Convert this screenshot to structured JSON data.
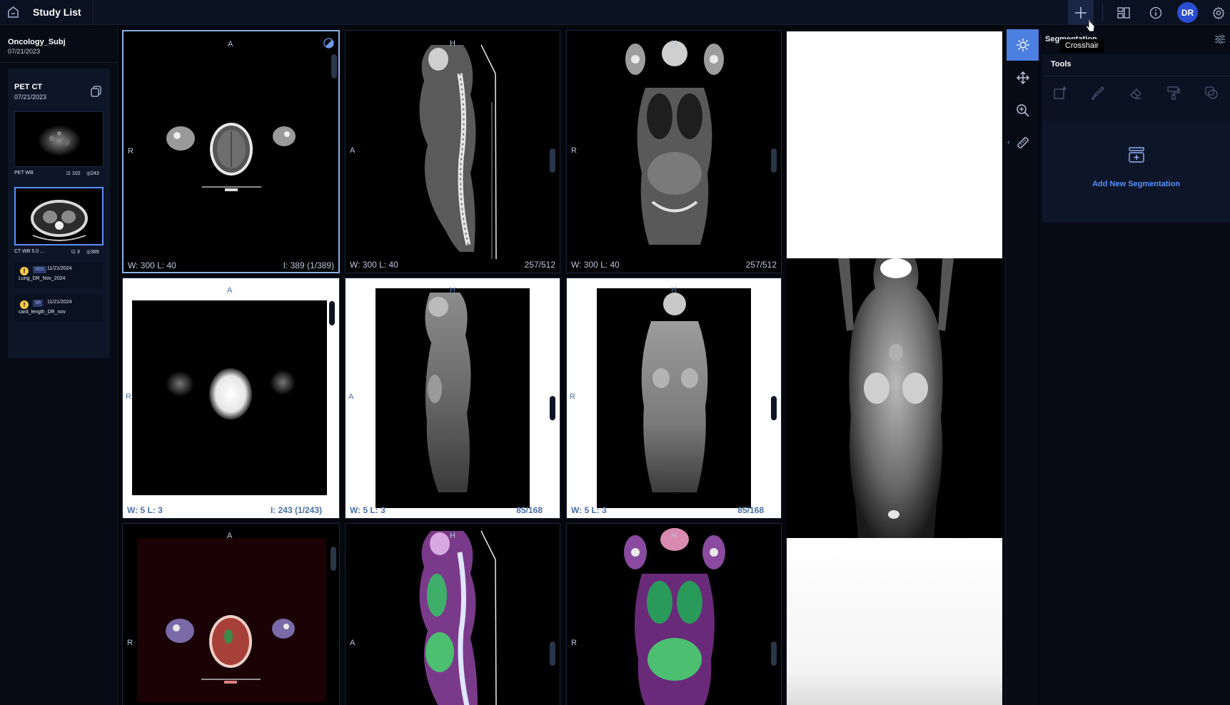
{
  "header": {
    "title": "Study List",
    "tooltip": "Crosshair",
    "user_initials": "DR",
    "icons": [
      "home-icon",
      "crosshair-icon",
      "layout-icon",
      "info-icon",
      "settings-icon"
    ]
  },
  "patient": {
    "name": "Oncology_Subj",
    "date": "07/21/2023"
  },
  "study": {
    "title": "PET CT",
    "date": "07/21/2023",
    "series": [
      {
        "label": "PET WB",
        "frames": "102",
        "images": "243"
      },
      {
        "label": "CT WB 5.0 ...",
        "frames": "3",
        "images": "389"
      }
    ],
    "derived": [
      {
        "type": "SEG",
        "date": "11/21/2024",
        "name": "Lung_DR_Nov_2024"
      },
      {
        "type": "SR",
        "date": "11/21/2024",
        "name": "card_length_DR_nov"
      }
    ]
  },
  "viewports": {
    "ct_axial": {
      "top": "A",
      "left": "R",
      "wl": "W:  300  L:  40",
      "index": "I: 389 (1/389)"
    },
    "ct_sagittal": {
      "top": "H",
      "left": "A",
      "wl": "W:  300  L:  40",
      "index": "257/512"
    },
    "ct_coronal": {
      "top": "H",
      "left": "R",
      "wl": "W:  300  L:  40",
      "index": "257/512"
    },
    "pt_axial": {
      "top": "A",
      "left": "R",
      "wl": "W:  5  L:  3",
      "index": "I: 243 (1/243)"
    },
    "pt_sagittal": {
      "top": "H",
      "left": "A",
      "wl": "W:  5  L:  3",
      "index": "85/168"
    },
    "pt_coronal": {
      "top": "H",
      "left": "R",
      "wl": "W:  5  L:  3",
      "index": "85/168"
    },
    "fu_axial": {
      "top": "A",
      "left": "R"
    },
    "fu_sagittal": {
      "top": "H",
      "left": "A"
    },
    "fu_coronal": {
      "top": "H",
      "left": "R"
    }
  },
  "segmentation_panel": {
    "title": "Segmentation",
    "tools_label": "Tools",
    "add_label": "Add New Segmentation"
  },
  "colors": {
    "accent": "#4b7fe0",
    "link": "#5b8ff9",
    "avatar": "#2b4dd1",
    "warning": "#f5c84c"
  }
}
